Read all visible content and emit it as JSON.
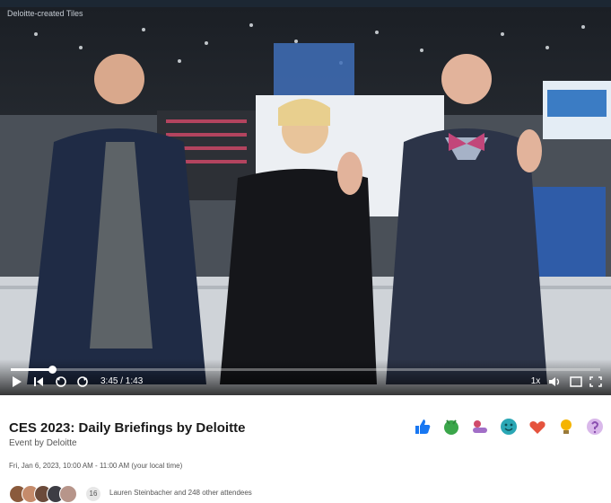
{
  "video": {
    "overlay_label": "Deloitte-created Tiles",
    "time": "3:45 / 1:43",
    "speed": "1x",
    "progress": 0.07
  },
  "event": {
    "title": "CES 2023: Daily Briefings by Deloitte",
    "organizer": "Event by Deloitte",
    "datetime": "Fri, Jan 6, 2023, 10:00 AM - 11:00 AM (your local time)"
  },
  "reactions": [
    {
      "icon": "like-icon",
      "color": "#1877f2"
    },
    {
      "icon": "celebrate-icon",
      "color": "#3aa64a"
    },
    {
      "icon": "support-icon",
      "color": "#a16ec7"
    },
    {
      "icon": "funny-icon",
      "color": "#2aa7b5"
    },
    {
      "icon": "love-icon",
      "color": "#e5533d"
    },
    {
      "icon": "insightful-icon",
      "color": "#f5b400"
    },
    {
      "icon": "curious-icon",
      "color": "#b57ad4"
    }
  ],
  "attendees": {
    "count_badge": "16",
    "text": "Lauren Steinbacher and 248 other attendees"
  },
  "colors": {
    "topbar": "#1c2733",
    "video_bg": "#2b2f36",
    "title_text": "#1a1a1a"
  }
}
